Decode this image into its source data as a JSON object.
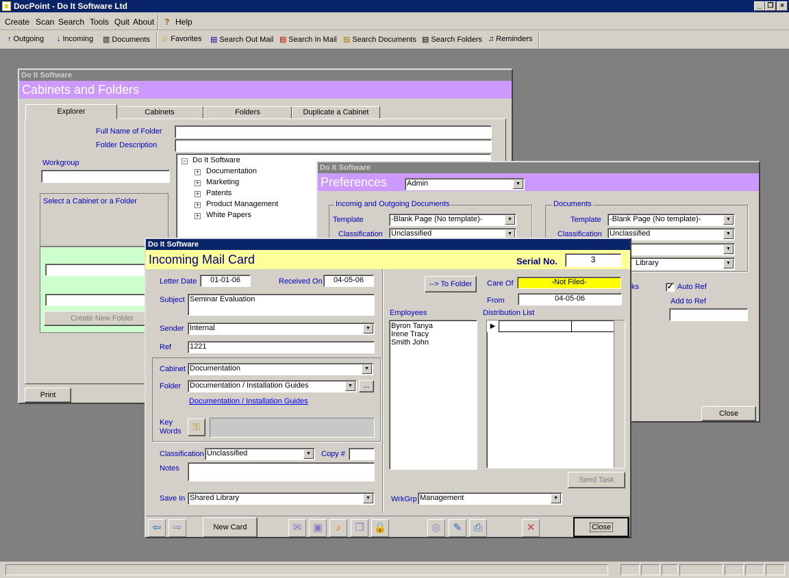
{
  "app": {
    "title": "DocPoint - Do It Software Ltd"
  },
  "menu": [
    "Create",
    "Scan",
    "Search",
    "Tools",
    "Quit",
    "About",
    "Help"
  ],
  "toolbar": {
    "outgoing": "Outgoing",
    "incoming": "Incoming",
    "documents": "Documents",
    "favorites": "Favorites",
    "search_out": "Search Out Mail",
    "search_in": "Search In Mail",
    "search_docs": "Search Documents",
    "search_folders": "Search Folders",
    "reminders": "Reminders"
  },
  "cabinets": {
    "titlebar": "Do It Software",
    "banner": "Cabinets and Folders",
    "tabs": [
      "Explorer",
      "Cabinets",
      "Folders",
      "Duplicate a Cabinet"
    ],
    "full_name_label": "Full Name of Folder",
    "folder_desc_label": "Folder Description",
    "workgroup_label": "Workgroup",
    "select_label": "Select a Cabinet or a Folder",
    "create_button": "Create New Folder",
    "print_button": "Print",
    "tree_root": "Do It Software",
    "tree_items": [
      "Documentation",
      "Marketing",
      "Patents",
      "Product Management",
      "White Papers"
    ]
  },
  "prefs": {
    "titlebar": "Do It Software",
    "banner": "Preferences",
    "user": "Admin",
    "group_in_out": "Incomig and Outgoing Documents",
    "group_docs": "Documents",
    "template_label": "Template",
    "template_value": "-Blank Page  (No template)-",
    "classification_label": "Classification",
    "classification_value": "Unclassified",
    "docs_template_value": "-Blank Page  (No template)-",
    "docs_classification_value": "Unclassified",
    "library_value": "Library",
    "partial_ks": "ks",
    "auto_ref_label": "Auto Ref",
    "add_to_ref_label": "Add to Ref",
    "close_button": "Close"
  },
  "mailcard": {
    "titlebar": "Do It Software",
    "banner": "Incoming Mail Card",
    "serial_label": "Serial No.",
    "serial_value": "3",
    "letter_date_label": "Letter Date",
    "letter_date": "01-01-06",
    "received_label": "Received On",
    "received": "04-05-06",
    "subject_label": "Subject",
    "subject": "Seminar Evaluation",
    "sender_label": "Sender",
    "sender": "Internal",
    "ref_label": "Ref",
    "ref": "1221",
    "cabinet_label": "Cabinet",
    "cabinet": "Documentation",
    "folder_label": "Folder",
    "folder": "Documentation / Installation Guides",
    "folder_link": "Documentation  / Installation Guides",
    "browse_label": "...",
    "keywords_label_1": "Key",
    "keywords_label_2": "Words",
    "classification_label": "Classification",
    "classification": "Unclassified",
    "copy_label": "Copy #",
    "notes_label": "Notes",
    "save_in_label": "Save In",
    "save_in": "Shared Library",
    "to_folder_button": "--> To Folder",
    "care_of_label": "Care Of",
    "care_of": "-Not Filed-",
    "from_label": "From",
    "from": "04-05-06",
    "employees_label": "Employees",
    "employees": [
      "Byron Tanya",
      "Irene Tracy",
      "Smith John"
    ],
    "distribution_label": "Distribution List",
    "send_task_button": "Send Task",
    "wrkgrp_label": "WrkGrp",
    "wrkgrp": "Management",
    "new_card_button": "New Card",
    "close_button": "Close"
  }
}
